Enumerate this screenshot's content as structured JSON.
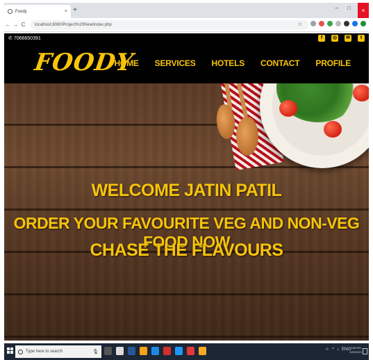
{
  "browser": {
    "tab_title": "Foody",
    "tab_close": "×",
    "new_tab": "+",
    "url": "localhost:8080/Project%20New/index.php",
    "minimize": "–",
    "maximize": "□",
    "close": "×",
    "back": "←",
    "forward": "→",
    "reload": "C",
    "star": "☆"
  },
  "site": {
    "phone": "7066650391",
    "logo": "FOODY",
    "menu": [
      {
        "label": "HOME"
      },
      {
        "label": "SERVICES"
      },
      {
        "label": "HOTELS"
      },
      {
        "label": "CONTACT"
      },
      {
        "label": "PROFILE"
      }
    ],
    "social": [
      "f",
      "◎",
      "✉",
      "t"
    ],
    "hero": {
      "line1": "WELCOME JATIN PATIL",
      "line2": "ORDER YOUR FAVOURITE VEG AND NON-VEG FOOD NOW",
      "line3": "CHASE THE FLAVOURS"
    }
  },
  "taskbar": {
    "search_placeholder": "Type here to search",
    "time": "3:56 PM",
    "date": "3/29/2021",
    "lang": "ENG"
  },
  "colors": {
    "accent": "#f7c40a",
    "navbar": "#000000",
    "taskbar": "#1c2635"
  }
}
